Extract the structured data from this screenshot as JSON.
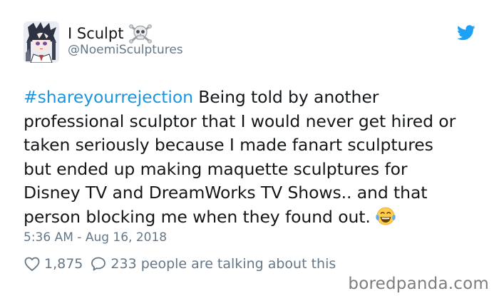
{
  "author": {
    "display_name": "I Sculpt",
    "handle": "@NoemiSculptures",
    "name_emoji_icon": "skull-and-crossbones-icon",
    "avatar_icon": "anime-character-avatar"
  },
  "platform_icon": "twitter-bird-icon",
  "tweet": {
    "hashtag": "#shareyourrejection",
    "lines": [
      " Being told by another",
      "professional sculptor that I would never get hired or",
      "taken seriously because I made fanart sculptures",
      "but ended up making maquette sculptures for",
      "Disney TV and DreamWorks TV Shows.. and that",
      "person blocking me when they found out."
    ],
    "end_emoji_icon": "face-with-tears-of-joy-icon",
    "timestamp": "5:36 AM - Aug 16, 2018"
  },
  "actions": {
    "like_icon": "heart-icon",
    "likes": "1,875",
    "reply_icon": "speech-bubble-icon",
    "talking": "233 people are talking about this"
  },
  "watermark": "boredpanda.com",
  "colors": {
    "hashtag": "#1b95e0",
    "twitter_blue": "#1da1f2",
    "secondary_text": "#657786"
  }
}
